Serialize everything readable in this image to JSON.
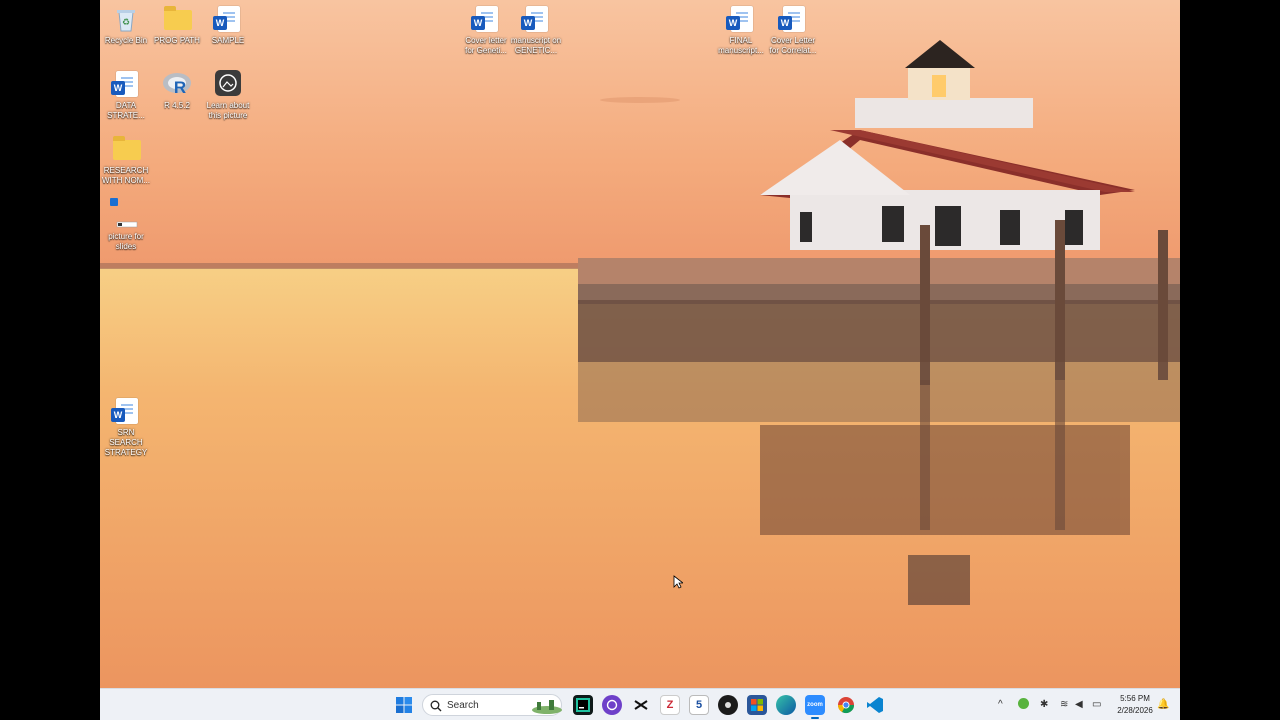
{
  "desktop": {
    "icons": [
      {
        "label": "Recycle Bin",
        "type": "recycle"
      },
      {
        "label": "PROG PATH",
        "type": "folder"
      },
      {
        "label": "SAMPLE",
        "type": "word"
      },
      {
        "label": "DATA STRATE...",
        "type": "word"
      },
      {
        "label": "R 4.5.2",
        "type": "r"
      },
      {
        "label": "Learn about this picture",
        "type": "learn"
      },
      {
        "label": "RESEARCH WITH NOM...",
        "type": "folder"
      },
      {
        "label": "picture for slides",
        "type": "image"
      },
      {
        "label": "SRN SEARCH STRATEGY",
        "type": "word"
      },
      {
        "label": "Cover letter for Geneti...",
        "type": "word"
      },
      {
        "label": "manuscript on GENETIC...",
        "type": "word"
      },
      {
        "label": "FINAL manuscript...",
        "type": "word"
      },
      {
        "label": "Cover Letter for Correlat...",
        "type": "word"
      }
    ],
    "word_badge": "W",
    "r_badge": "R"
  },
  "taskbar": {
    "search_placeholder": "Search",
    "time": "5:56 PM",
    "date": "2/28/2026",
    "apps": [
      "windows-start",
      "widgets-landscape",
      "jetbrains-pycharm",
      "github-desktop",
      "capcut",
      "zotero",
      "five-app",
      "obs-studio",
      "microsoft-store",
      "edge-browser",
      "zoom",
      "chrome",
      "vscode"
    ],
    "zotero_letter": "Z",
    "five_letter": "5",
    "zoom_text": "zoom"
  },
  "colors": {
    "sky_top": "#f6b98a",
    "water": "#f2aa6c",
    "word_blue": "#185abd",
    "taskbar": "#eef1f6"
  }
}
